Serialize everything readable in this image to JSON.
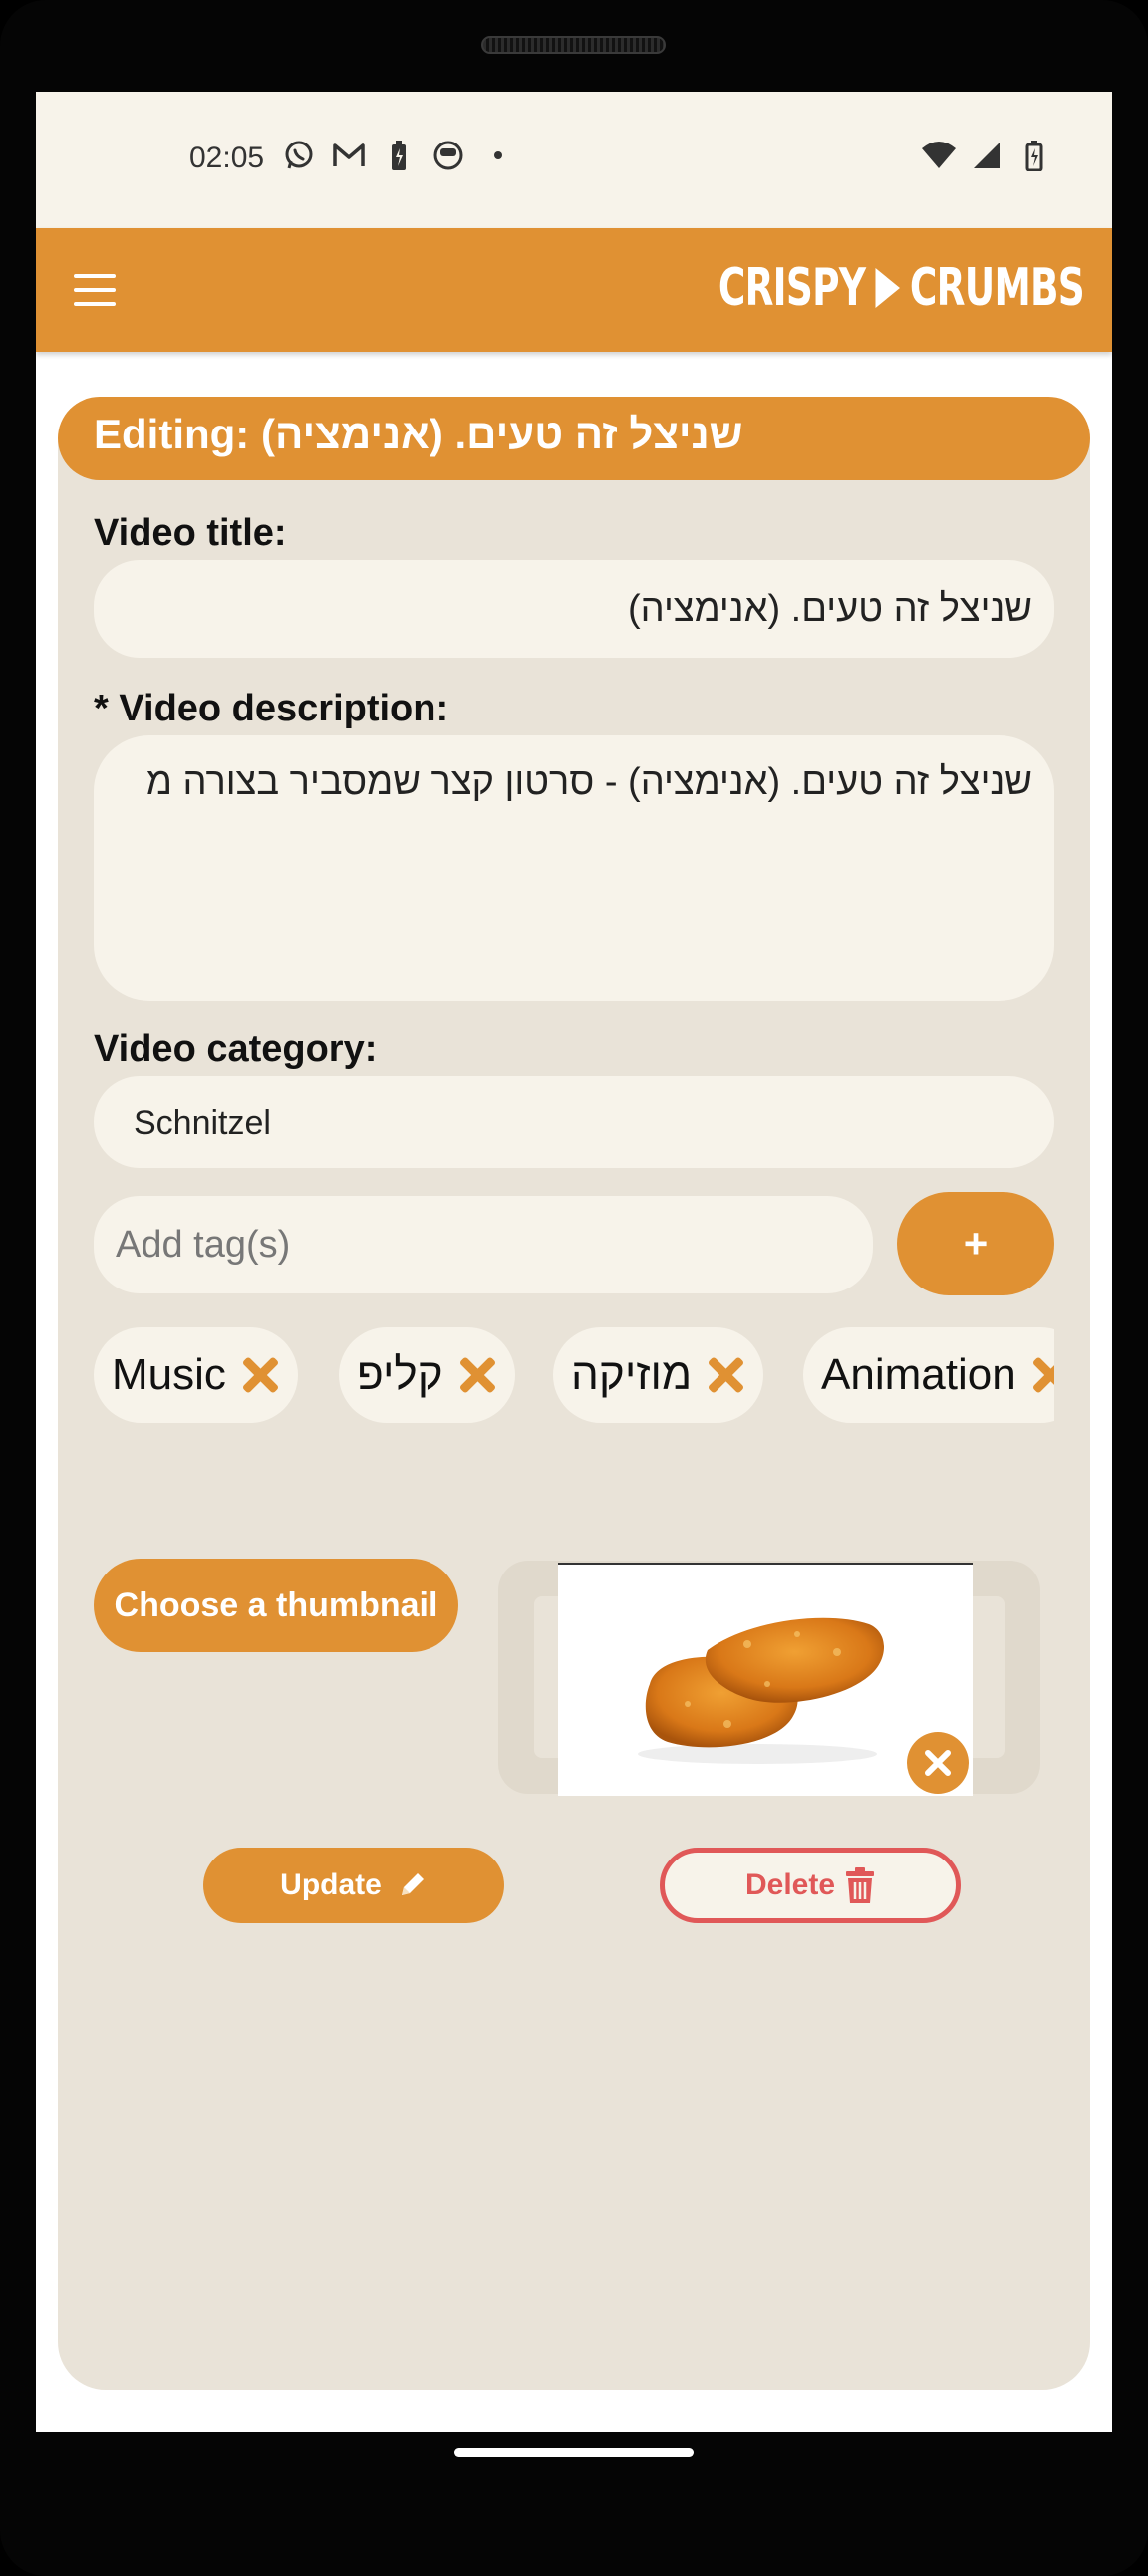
{
  "status_bar": {
    "time": "02:05",
    "left_icons": [
      "whatsapp-icon",
      "gmail-icon",
      "battery-charging-icon",
      "app-icon",
      "dot-icon"
    ],
    "right_icons": [
      "wifi-icon",
      "signal-icon",
      "battery-icon"
    ]
  },
  "app_bar": {
    "logo_left": "CRISPY",
    "logo_right": "CRUMBS",
    "menu_icon": "hamburger-menu-icon"
  },
  "editor": {
    "header": "Editing: שניצל זה טעים. (אנימציה)",
    "title_label": "Video title:",
    "title_value": "שניצל זה טעים. (אנימציה)",
    "description_label": "* Video description:",
    "description_value": "שניצל זה טעים. (אנימציה) - סרטון קצר שמסביר בצורה מ",
    "category_label": "Video category:",
    "category_value": "Schnitzel",
    "tag_placeholder": "Add tag(s)",
    "add_tag_label": "+",
    "tags": [
      {
        "label": "Music"
      },
      {
        "label": "קליפ"
      },
      {
        "label": "מוזיקה"
      },
      {
        "label": "Animation"
      }
    ],
    "choose_thumbnail_label": "Choose a thumbnail",
    "update_label": "Update",
    "delete_label": "Delete"
  },
  "colors": {
    "accent": "#e09133",
    "card_bg": "#e9e3d8",
    "field_bg": "#f7f3ea",
    "danger": "#e05858"
  }
}
